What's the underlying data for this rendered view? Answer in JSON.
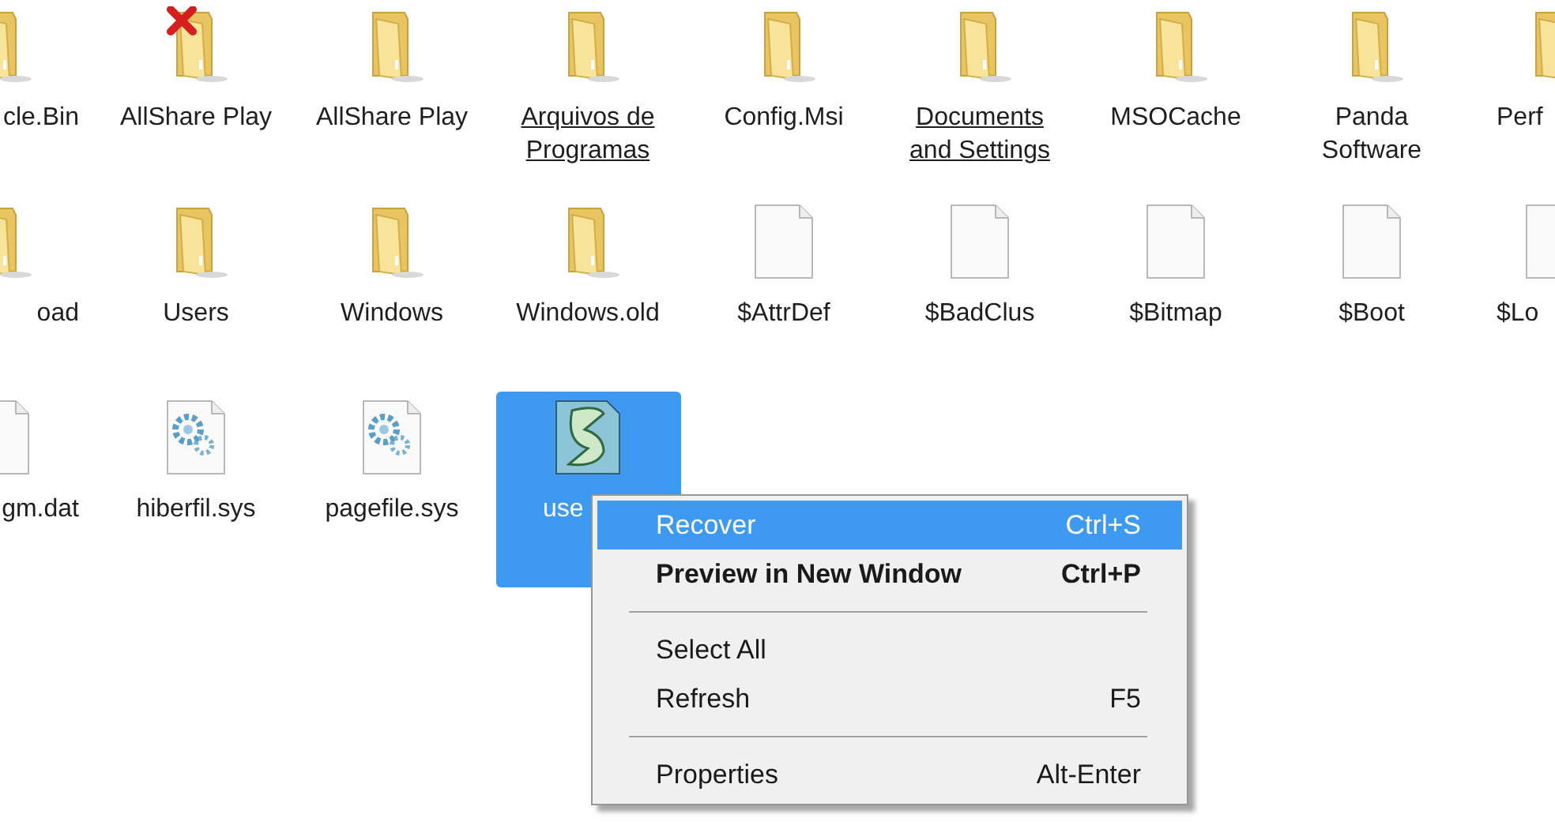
{
  "items": [
    {
      "label": "cle.Bin",
      "kind": "folder",
      "underlined": false,
      "selected": false
    },
    {
      "label": "AllShare Play",
      "kind": "folder-deleted",
      "underlined": false,
      "selected": false
    },
    {
      "label": "AllShare Play",
      "kind": "folder",
      "underlined": false,
      "selected": false
    },
    {
      "label": "Arquivos de Programas",
      "kind": "folder",
      "underlined": true,
      "selected": false
    },
    {
      "label": "Config.Msi",
      "kind": "folder",
      "underlined": false,
      "selected": false
    },
    {
      "label": "Documents and Settings",
      "kind": "folder",
      "underlined": true,
      "selected": false
    },
    {
      "label": "MSOCache",
      "kind": "folder",
      "underlined": false,
      "selected": false
    },
    {
      "label": "Panda Software",
      "kind": "folder",
      "underlined": false,
      "selected": false
    },
    {
      "label": "Perf",
      "kind": "folder",
      "underlined": false,
      "selected": false
    },
    {
      "label": "oad",
      "kind": "folder",
      "underlined": false,
      "selected": false
    },
    {
      "label": "Users",
      "kind": "folder",
      "underlined": false,
      "selected": false
    },
    {
      "label": "Windows",
      "kind": "folder",
      "underlined": false,
      "selected": false
    },
    {
      "label": "Windows.old",
      "kind": "folder",
      "underlined": false,
      "selected": false
    },
    {
      "label": "$AttrDef",
      "kind": "file",
      "underlined": false,
      "selected": false
    },
    {
      "label": "$BadClus",
      "kind": "file",
      "underlined": false,
      "selected": false
    },
    {
      "label": "$Bitmap",
      "kind": "file",
      "underlined": false,
      "selected": false
    },
    {
      "label": "$Boot",
      "kind": "file",
      "underlined": false,
      "selected": false
    },
    {
      "label": "$Lo",
      "kind": "file",
      "underlined": false,
      "selected": false
    },
    {
      "label": "gm.dat",
      "kind": "file",
      "underlined": false,
      "selected": false
    },
    {
      "label": "hiberfil.sys",
      "kind": "system",
      "underlined": false,
      "selected": false
    },
    {
      "label": "pagefile.sys",
      "kind": "system",
      "underlined": false,
      "selected": false
    },
    {
      "label": "use",
      "kind": "script",
      "underlined": false,
      "selected": true
    }
  ],
  "context_menu": {
    "items": [
      {
        "kind": "item",
        "label": "Recover",
        "shortcut": "Ctrl+S",
        "bold": false,
        "selected": true
      },
      {
        "kind": "item",
        "label": "Preview in New Window",
        "shortcut": "Ctrl+P",
        "bold": true,
        "selected": false
      },
      {
        "kind": "separator"
      },
      {
        "kind": "item",
        "label": "Select All",
        "bold": false,
        "selected": false
      },
      {
        "kind": "item",
        "label": "Refresh",
        "shortcut": "F5",
        "bold": false,
        "selected": false
      },
      {
        "kind": "separator"
      },
      {
        "kind": "item",
        "label": "Properties",
        "shortcut": "Alt-Enter",
        "bold": false,
        "selected": false
      }
    ]
  }
}
